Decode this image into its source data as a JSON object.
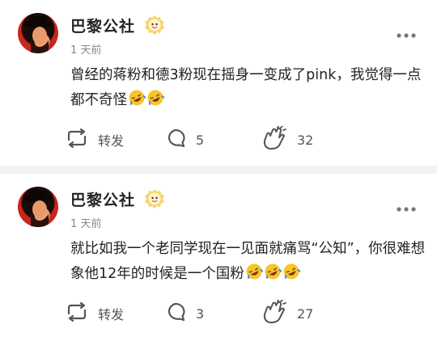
{
  "posts": [
    {
      "username": "巴黎公社",
      "timestamp": "1 天前",
      "text": "曾经的蒋粉和德3粉现在摇身一变成了pink，我觉得一点都不奇怪",
      "emoji_count": 2,
      "emoji_name": "rofl-emoji",
      "repost_label": "转发",
      "comment_count": "5",
      "like_count": "32"
    },
    {
      "username": "巴黎公社",
      "timestamp": "1 天前",
      "text": "就比如我一个老同学现在一见面就痛骂“公知”，你很难想象他12年的时候是一个国粉",
      "emoji_count": 3,
      "emoji_name": "rofl-emoji",
      "repost_label": "转发",
      "comment_count": "3",
      "like_count": "27"
    }
  ],
  "colors": {
    "icon_gray": "#555555",
    "emoji_yellow": "#f7c52b",
    "emoji_blue": "#3a8ee6",
    "avatar_red": "#c8261e",
    "separator": "#f2f2f2"
  }
}
